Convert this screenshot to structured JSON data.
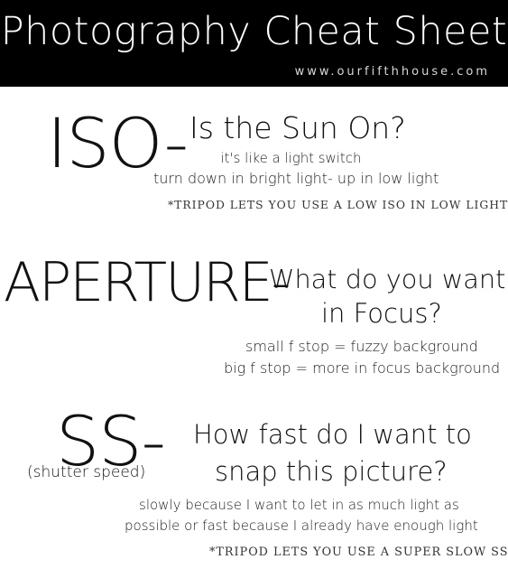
{
  "header": {
    "title": "Photography Cheat Sheet",
    "url": "www.ourfifthhouse.com",
    "background": "#000000"
  },
  "iso": {
    "term": "ISO-",
    "question": "Is the Sun On?",
    "lines": [
      "it's like a light switch",
      "turn down in bright light- up in low light"
    ],
    "tip": "*TRIPOD LETS YOU USE A LOW ISO IN LOW LIGHT"
  },
  "aperture": {
    "term": "APERTURE-",
    "question_line1": "What do you want",
    "question_line2": "in Focus?",
    "lines": [
      "small f stop = fuzzy background",
      "big f stop = more in focus background"
    ]
  },
  "ss": {
    "term": "SS-",
    "subtitle": "(shutter speed)",
    "question_line1": "How fast do I want to",
    "question_line2": "snap this picture?",
    "lines": [
      "slowly because I want to let in as much light as",
      "possible or fast because I already have enough light"
    ],
    "tip": "*TRIPOD LETS YOU USE A SUPER SLOW SS"
  }
}
